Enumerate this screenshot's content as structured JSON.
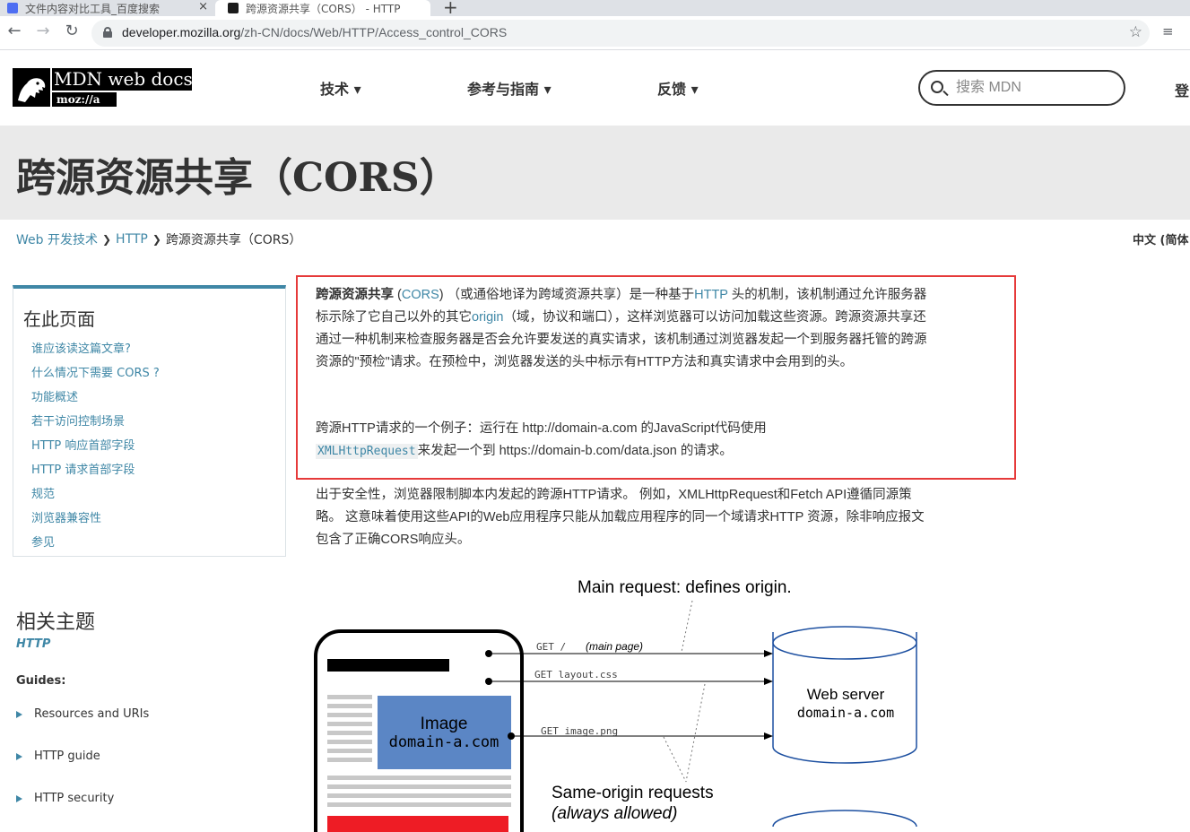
{
  "browser": {
    "tabs": [
      {
        "title": "文件内容对比工具_百度搜索"
      },
      {
        "title": "跨源资源共享（CORS） - HTTP"
      }
    ],
    "new_tab_glyph": "+",
    "close_glyph": "×",
    "url_host": "developer.mozilla.org",
    "url_path": "/zh-CN/docs/Web/HTTP/Access_control_CORS"
  },
  "header": {
    "logo_wordmark": "MDN web docs",
    "logo_moz": "moz://a",
    "nav": [
      {
        "label": "技术 ▾"
      },
      {
        "label": "参考与指南 ▾"
      },
      {
        "label": "反馈 ▾"
      }
    ],
    "search_placeholder": "搜索 MDN",
    "signin_label": "登"
  },
  "page": {
    "title": "跨源资源共享（CORS）",
    "breadcrumbs": [
      "Web 开发技术",
      "HTTP",
      "跨源资源共享（CORS）"
    ],
    "breadcrumb_separator": "❯",
    "language": "中文 (简体"
  },
  "toc": {
    "heading": "在此页面",
    "items": [
      "谁应该读这篇文章?",
      "什么情况下需要 CORS ?",
      "功能概述",
      "若干访问控制场景",
      "HTTP 响应首部字段",
      "HTTP 请求首部字段",
      "规范",
      "浏览器兼容性",
      "参见"
    ]
  },
  "related": {
    "title": "相关主题",
    "topic": "HTTP",
    "guides_label": "Guides:",
    "guides": [
      "Resources and URIs",
      "HTTP guide",
      "HTTP security"
    ]
  },
  "article": {
    "intro": {
      "term": "跨源资源共享",
      "open_paren": " (",
      "term_link": "CORS",
      "part1": ") （或通俗地译为跨域资源共享）是一种基于",
      "http_link": "HTTP",
      "part2": " 头的机制，该机制通过允许服务器标示除了它自己以外的其它",
      "origin_link": "origin",
      "part3": "（域，协议和端口），这样浏览器可以访问加载这些资源。跨源资源共享还通过一种机制来检查服务器是否会允许要发送的真实请求，该机制通过浏览器发起一个到服务器托管的跨源资源的\"预检\"请求。在预检中，浏览器发送的头中标示有HTTP方法和真实请求中会用到的头。"
    },
    "example": {
      "part1": "跨源HTTP请求的一个例子：运行在 http://domain-a.com 的JavaScript代码使用",
      "code": "XMLHttpRequest",
      "part2": "来发起一个到 https://domain-b.com/data.json 的请求。"
    },
    "security": "出于安全性，浏览器限制脚本内发起的跨源HTTP请求。 例如，XMLHttpRequest和Fetch API遵循同源策略。 这意味着使用这些API的Web应用程序只能从加载应用程序的同一个域请求HTTP 资源，除非响应报文包含了正确CORS响应头。"
  },
  "diagram": {
    "caption_top": "Main request: defines origin.",
    "requests": [
      "GET /",
      "(main page)",
      "GET layout.css",
      "GET image.png"
    ],
    "image_label": "Image",
    "image_domain": "domain-a.com",
    "server_label": "Web server",
    "server_domain": "domain-a.com",
    "same_origin_line1": "Same-origin requests",
    "same_origin_line2": "(always allowed)",
    "colors": {
      "image_box": "#5b86c5",
      "red_box": "#ee1c25"
    }
  }
}
